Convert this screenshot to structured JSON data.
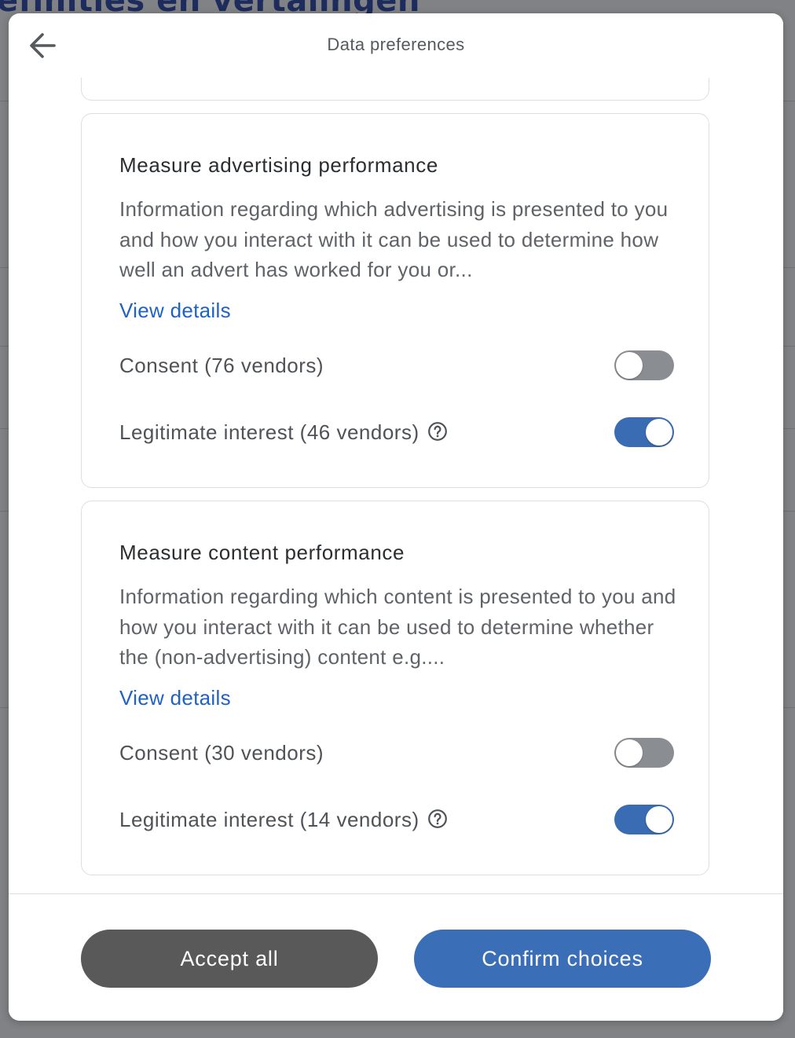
{
  "background": {
    "heading": "efinities en vertalingen"
  },
  "header": {
    "title": "Data preferences",
    "back_icon": "arrow-left-icon"
  },
  "purposes": [
    {
      "title": "Measure advertising performance",
      "description": "Information regarding which advertising is presented to you and how you interact with it can be used to determine how well an advert has worked for you or...",
      "view_details": "View details",
      "consent_label": "Consent (76 vendors)",
      "consent_on": false,
      "legit_label": "Legitimate interest (46 vendors)",
      "legit_on": true
    },
    {
      "title": "Measure content performance",
      "description": "Information regarding which content is presented to you and how you interact with it can be used to determine whether the (non-advertising) content e.g....",
      "view_details": "View details",
      "consent_label": "Consent (30 vendors)",
      "consent_on": false,
      "legit_label": "Legitimate interest (14 vendors)",
      "legit_on": true
    }
  ],
  "footer": {
    "accept_all": "Accept all",
    "confirm_choices": "Confirm choices"
  },
  "colors": {
    "primary": "#3a6fb8",
    "secondary": "#595959",
    "link": "#1f61c4",
    "toggle_off": "#8a8e92"
  }
}
